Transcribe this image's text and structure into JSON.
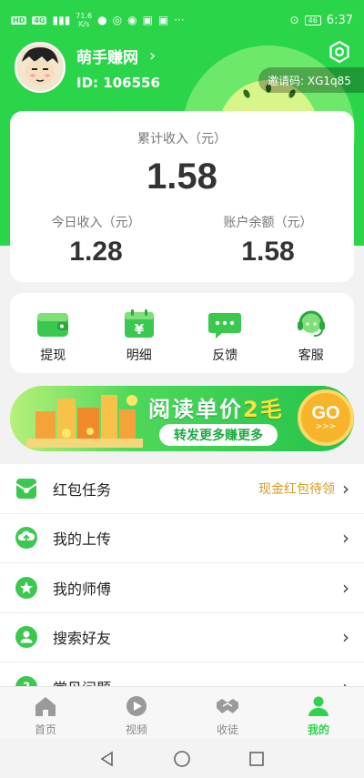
{
  "status_bar": {
    "net_badge_1": "HD",
    "net_badge_2": "4G",
    "speed": "71.6",
    "speed_unit": "K/s",
    "battery": "46",
    "time": "6:37"
  },
  "profile": {
    "username": "萌手赚网",
    "user_id": "ID: 106556",
    "invite_code": "邀请码: XG1q85"
  },
  "earnings": {
    "total_label": "累计收入（元）",
    "total_value": "1.58",
    "today_label": "今日收入（元）",
    "today_value": "1.28",
    "balance_label": "账户余额（元）",
    "balance_value": "1.58"
  },
  "actions": [
    {
      "label": "提现",
      "icon": "wallet-icon"
    },
    {
      "label": "明细",
      "icon": "calendar-yuan-icon"
    },
    {
      "label": "反馈",
      "icon": "chat-bubble-icon"
    },
    {
      "label": "客服",
      "icon": "headset-icon"
    }
  ],
  "banner": {
    "title_a": "阅读单价",
    "title_b": "2毛",
    "subtitle": "转发更多赚更多",
    "go": "GO",
    "go_arrows": ">>>"
  },
  "menu": [
    {
      "label": "红包任务",
      "note": "现金红包待领",
      "icon": "red-envelope-icon"
    },
    {
      "label": "我的上传",
      "note": "",
      "icon": "cloud-upload-icon"
    },
    {
      "label": "我的师傅",
      "note": "",
      "icon": "star-icon"
    },
    {
      "label": "搜索好友",
      "note": "",
      "icon": "user-search-icon"
    },
    {
      "label": "常见问题",
      "note": "",
      "icon": "question-icon"
    }
  ],
  "bottom_nav": [
    {
      "label": "首页",
      "icon": "home-icon",
      "active": false
    },
    {
      "label": "视频",
      "icon": "play-icon",
      "active": false
    },
    {
      "label": "收徒",
      "icon": "handshake-icon",
      "active": false
    },
    {
      "label": "我的",
      "icon": "person-icon",
      "active": true
    }
  ],
  "colors": {
    "brand_green": "#2ad54a",
    "note_gold": "#d39a1e",
    "inactive_gray": "#888888"
  }
}
